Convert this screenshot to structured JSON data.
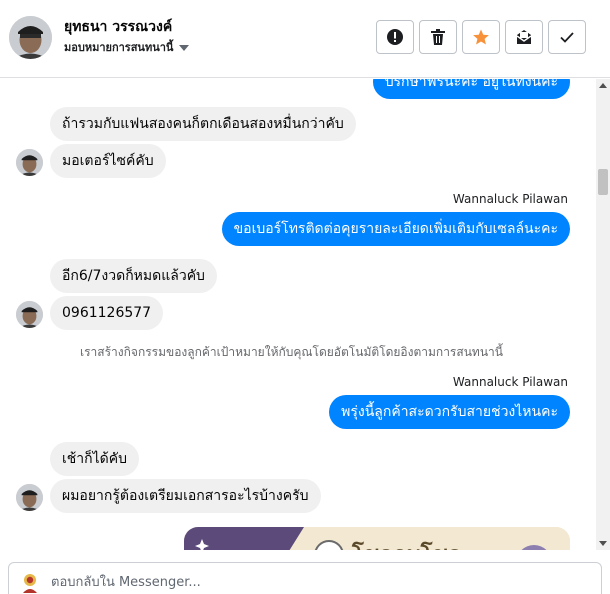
{
  "header": {
    "contact_name": "ยุทธนา วรรณวงค์",
    "assignment_label": "มอบหมายการสนทนานี้",
    "actions": [
      {
        "name": "mark-spam-button",
        "icon": "exclamation-icon"
      },
      {
        "name": "delete-button",
        "icon": "trash-icon"
      },
      {
        "name": "star-button",
        "icon": "star-icon"
      },
      {
        "name": "mark-unread-button",
        "icon": "envelope-icon"
      },
      {
        "name": "mark-done-button",
        "icon": "checkmark-icon"
      }
    ]
  },
  "messages": {
    "out_top": "ปรึกษาฟรีนะคะ อยู่ในทั้งนี้คะ",
    "in_1": "ถ้ารวมกับแฟนสองคนก็ตกเดือนสองหมื่นกว่าคับ",
    "in_2": "มอเตอร์ไซค์คับ",
    "sender_1": "Wannaluck Pilawan",
    "out_1": "ขอเบอร์โทรติดต่อคุยรายละเอียดเพิ่มเติมกับเซลล์นะคะ",
    "in_3": "อีก6/7งวดก็หมดแล้วคับ",
    "in_4": "0961126577",
    "system_note": "เราสร้างกิจกรรมของลูกค้าเป้าหมายให้กับคุณโดยอัตโนมัติโดยอิงตามการสนทนานี้",
    "sender_2": "Wannaluck Pilawan",
    "out_2": "พรุ่งนี้ลูกค้าสะดวกรับสายช่วงไหนคะ",
    "in_5": "เช้าก็ได้คับ",
    "in_6": "ผมอยากรู้ต้องเตรียมเอกสารอะไรบ้างครับ",
    "promo_text": "โชคอุบโชค"
  },
  "reply": {
    "placeholder": "ตอบกลับใน Messenger..."
  },
  "colors": {
    "outgoing_bubble": "#0084ff",
    "incoming_bubble": "#f0f0f0",
    "star": "#f7923b"
  }
}
